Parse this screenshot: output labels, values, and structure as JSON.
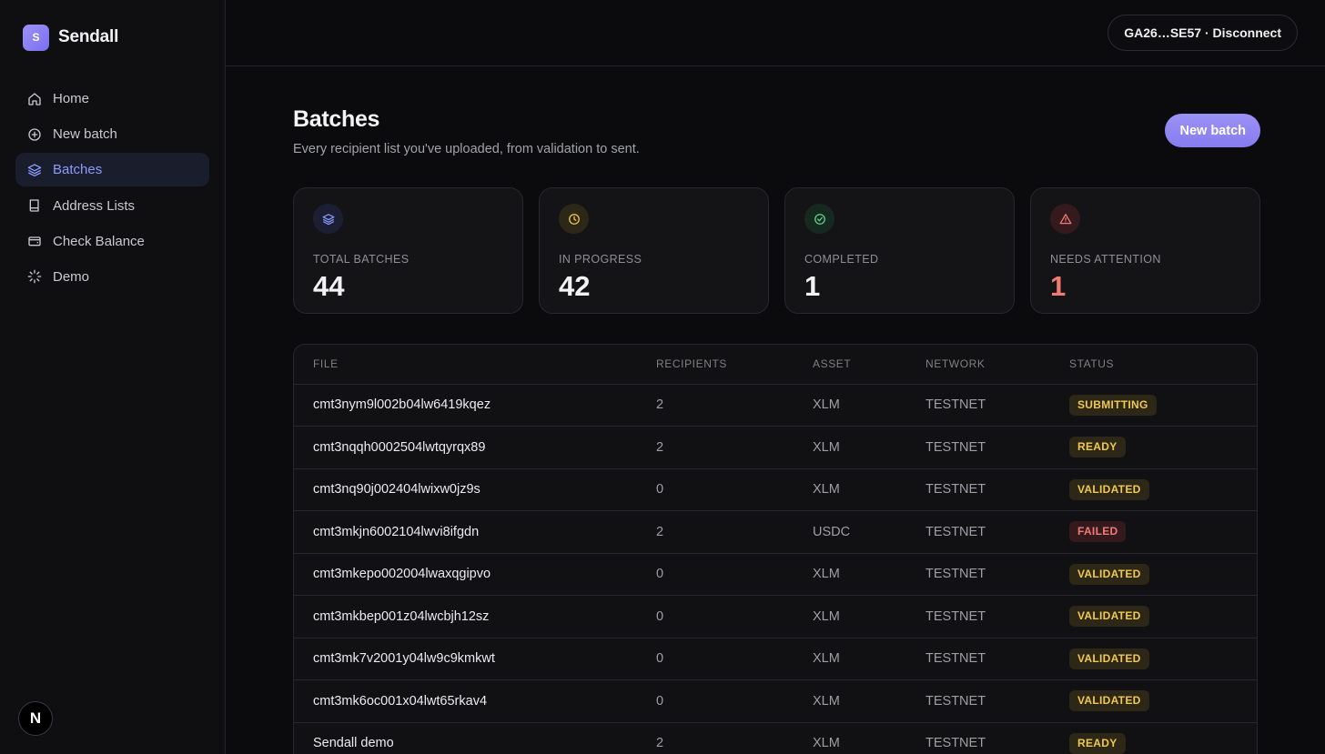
{
  "brand": {
    "logo_letter": "S",
    "name": "Sendall"
  },
  "nav": [
    {
      "label": "Home",
      "icon": "home-icon",
      "active": false
    },
    {
      "label": "New batch",
      "icon": "plus-circle-icon",
      "active": false
    },
    {
      "label": "Batches",
      "icon": "layers-icon",
      "active": true
    },
    {
      "label": "Address Lists",
      "icon": "book-icon",
      "active": false
    },
    {
      "label": "Check Balance",
      "icon": "wallet-icon",
      "active": false
    },
    {
      "label": "Demo",
      "icon": "spinner-icon",
      "active": false
    }
  ],
  "footer_badge": "N",
  "header": {
    "wallet_label": "GA26…SE57 · Disconnect"
  },
  "page": {
    "title": "Batches",
    "subtitle": "Every recipient list you've uploaded, from validation to sent.",
    "new_batch_label": "New batch"
  },
  "stats": [
    {
      "label": "TOTAL BATCHES",
      "value": "44",
      "icon": "layers-icon",
      "color": "#8a9cff",
      "icon_bg": "#1c1f33"
    },
    {
      "label": "IN PROGRESS",
      "value": "42",
      "icon": "clock-icon",
      "color": "#f2c94c",
      "icon_bg": "#2c2716"
    },
    {
      "label": "COMPLETED",
      "value": "1",
      "icon": "check-circle-icon",
      "color": "#5fd38d",
      "icon_bg": "#16291f"
    },
    {
      "label": "NEEDS ATTENTION",
      "value": "1",
      "icon": "alert-triangle-icon",
      "color": "#ef7b72",
      "icon_bg": "#341a1c"
    }
  ],
  "table": {
    "headers": [
      "FILE",
      "RECIPIENTS",
      "ASSET",
      "NETWORK",
      "STATUS"
    ],
    "rows": [
      {
        "file": "cmt3nym9l002b04lw6419kqez",
        "recipients": "2",
        "asset": "XLM",
        "network": "TESTNET",
        "status": "SUBMITTING",
        "tone": "amber"
      },
      {
        "file": "cmt3nqqh0002504lwtqyrqx89",
        "recipients": "2",
        "asset": "XLM",
        "network": "TESTNET",
        "status": "READY",
        "tone": "amber"
      },
      {
        "file": "cmt3nq90j002404lwixw0jz9s",
        "recipients": "0",
        "asset": "XLM",
        "network": "TESTNET",
        "status": "VALIDATED",
        "tone": "amber"
      },
      {
        "file": "cmt3mkjn6002104lwvi8ifgdn",
        "recipients": "2",
        "asset": "USDC",
        "network": "TESTNET",
        "status": "FAILED",
        "tone": "red"
      },
      {
        "file": "cmt3mkepo002004lwaxqgipvo",
        "recipients": "0",
        "asset": "XLM",
        "network": "TESTNET",
        "status": "VALIDATED",
        "tone": "amber"
      },
      {
        "file": "cmt3mkbep001z04lwcbjh12sz",
        "recipients": "0",
        "asset": "XLM",
        "network": "TESTNET",
        "status": "VALIDATED",
        "tone": "amber"
      },
      {
        "file": "cmt3mk7v2001y04lw9c9kmkwt",
        "recipients": "0",
        "asset": "XLM",
        "network": "TESTNET",
        "status": "VALIDATED",
        "tone": "amber"
      },
      {
        "file": "cmt3mk6oc001x04lwt65rkav4",
        "recipients": "0",
        "asset": "XLM",
        "network": "TESTNET",
        "status": "VALIDATED",
        "tone": "amber"
      },
      {
        "file": "Sendall demo",
        "recipients": "2",
        "asset": "XLM",
        "network": "TESTNET",
        "status": "READY",
        "tone": "amber"
      }
    ]
  }
}
